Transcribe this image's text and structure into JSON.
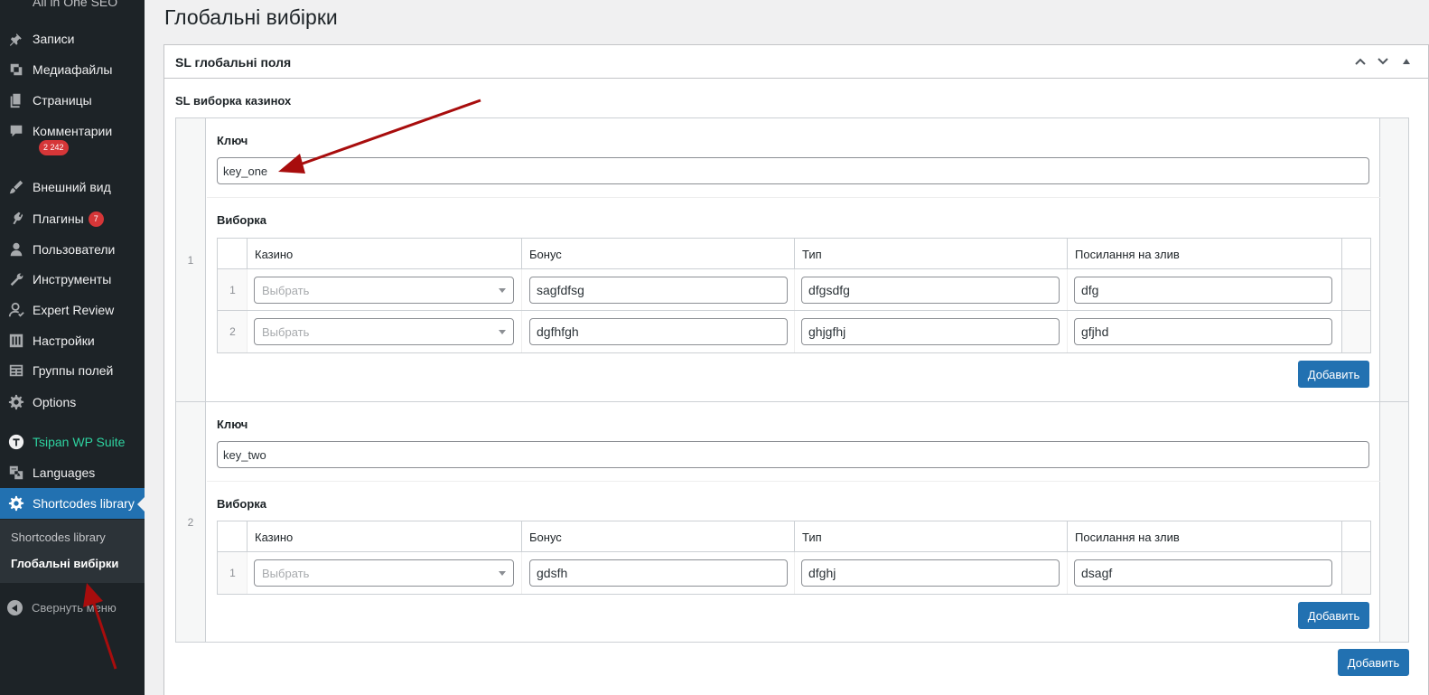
{
  "sidebar": {
    "top_cut": "All in One SEO",
    "items": [
      {
        "label": "Записи",
        "icon": "pin-icon"
      },
      {
        "label": "Медиафайлы",
        "icon": "media-icon"
      },
      {
        "label": "Страницы",
        "icon": "pages-icon"
      },
      {
        "label": "Комментарии",
        "icon": "comments-icon",
        "badge": "2 242"
      },
      {
        "label": "Внешний вид",
        "icon": "brush-icon"
      },
      {
        "label": "Плагины",
        "icon": "plugin-icon",
        "badge": "7"
      },
      {
        "label": "Пользователи",
        "icon": "user-icon"
      },
      {
        "label": "Инструменты",
        "icon": "wrench-icon"
      },
      {
        "label": "Expert Review",
        "icon": "reviewer-icon"
      },
      {
        "label": "Настройки",
        "icon": "sliders-icon"
      },
      {
        "label": "Группы полей",
        "icon": "table-icon"
      },
      {
        "label": "Options",
        "icon": "gear-icon"
      },
      {
        "label": "Tsipan WP Suite",
        "icon": "t-logo-icon"
      },
      {
        "label": "Languages",
        "icon": "translate-icon"
      },
      {
        "label": "Shortcodes library",
        "icon": "gear-icon"
      }
    ],
    "submenu": [
      "Shortcodes library",
      "Глобальні вибірки"
    ],
    "collapse_label": "Свернуть меню"
  },
  "page": {
    "title": "Глобальні вибірки",
    "postbox_title": "SL глобальні поля",
    "field_label": "SL виборка казинох"
  },
  "repeater": {
    "key_label": "Ключ",
    "selection_label": "Виборка",
    "columns": [
      "Казино",
      "Бонус",
      "Тип",
      "Посилання на злив"
    ],
    "select_placeholder": "Выбрать",
    "add_label": "Добавить",
    "rows": [
      {
        "index": "1",
        "key": "key_one",
        "items": [
          {
            "index": "1",
            "bonus": "sagfdfsg",
            "type": "dfgsdfg",
            "link": "dfg"
          },
          {
            "index": "2",
            "bonus": "dgfhfgh",
            "type": "ghjgfhj",
            "link": "gfjhd"
          }
        ]
      },
      {
        "index": "2",
        "key": "key_two",
        "items": [
          {
            "index": "1",
            "bonus": "gdsfh",
            "type": "dfghj",
            "link": "dsagf"
          }
        ]
      }
    ]
  },
  "colors": {
    "sidebar_bg": "#1d2327",
    "accent": "#2271b1",
    "badge": "#d63638",
    "arrow": "#a80d0d"
  }
}
